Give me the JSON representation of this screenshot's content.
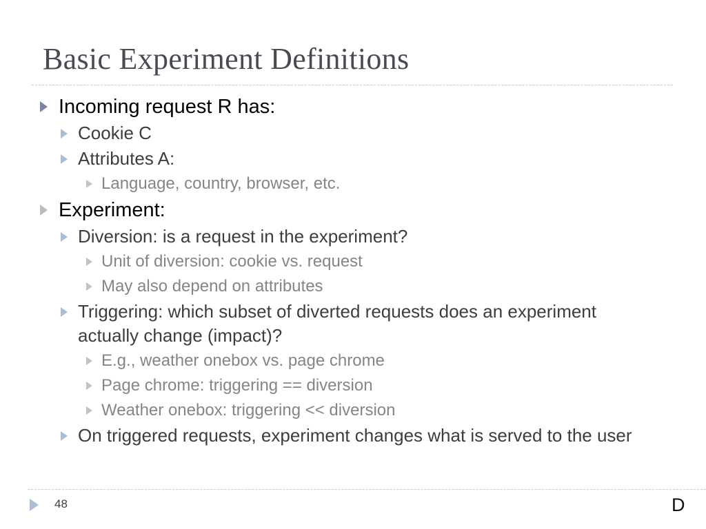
{
  "slide": {
    "title": "Basic Experiment Definitions",
    "bullets": [
      {
        "level": 1,
        "text": "Incoming request R has:",
        "marker": "triangle-accent"
      },
      {
        "level": 2,
        "text": "Cookie C",
        "marker": "triangle-light-blue"
      },
      {
        "level": 2,
        "text": "Attributes A:",
        "marker": "triangle-light-blue"
      },
      {
        "level": 3,
        "text": "Language, country, browser, etc.",
        "marker": "triangle-gray"
      },
      {
        "level": 1,
        "text": "Experiment:",
        "marker": "triangle-gray"
      },
      {
        "level": 2,
        "text": "Diversion: is a request in the experiment?",
        "marker": "triangle-light-blue"
      },
      {
        "level": 3,
        "text": "Unit of diversion: cookie vs. request",
        "marker": "triangle-gray"
      },
      {
        "level": 3,
        "text": "May also depend on attributes",
        "marker": "triangle-gray"
      },
      {
        "level": 2,
        "text": "Triggering: which subset of diverted requests does an experiment actually change (impact)?",
        "marker": "triangle-light-blue"
      },
      {
        "level": 3,
        "text": "E.g., weather onebox vs. page chrome",
        "marker": "triangle-gray"
      },
      {
        "level": 3,
        "text": "Page chrome: triggering == diversion",
        "marker": "triangle-gray"
      },
      {
        "level": 3,
        "text": "Weather onebox: triggering << diversion",
        "marker": "triangle-gray"
      },
      {
        "level": 2,
        "text": "On triggered requests, experiment changes what is served to the user",
        "marker": "triangle-light-blue"
      }
    ]
  },
  "footer": {
    "slide_number": "48",
    "corner_mark": "D"
  },
  "colors": {
    "title_text": "#4a4a55",
    "level1_text": "#000000",
    "level2_text": "#3d3d3d",
    "level3_text": "#858585",
    "accent_triangle": "#7d83aa",
    "light_blue_triangle": "#a9bed6",
    "gray_triangle": "#c2c2c2",
    "rule": "#c8c8c8",
    "background": "#ffffff"
  }
}
